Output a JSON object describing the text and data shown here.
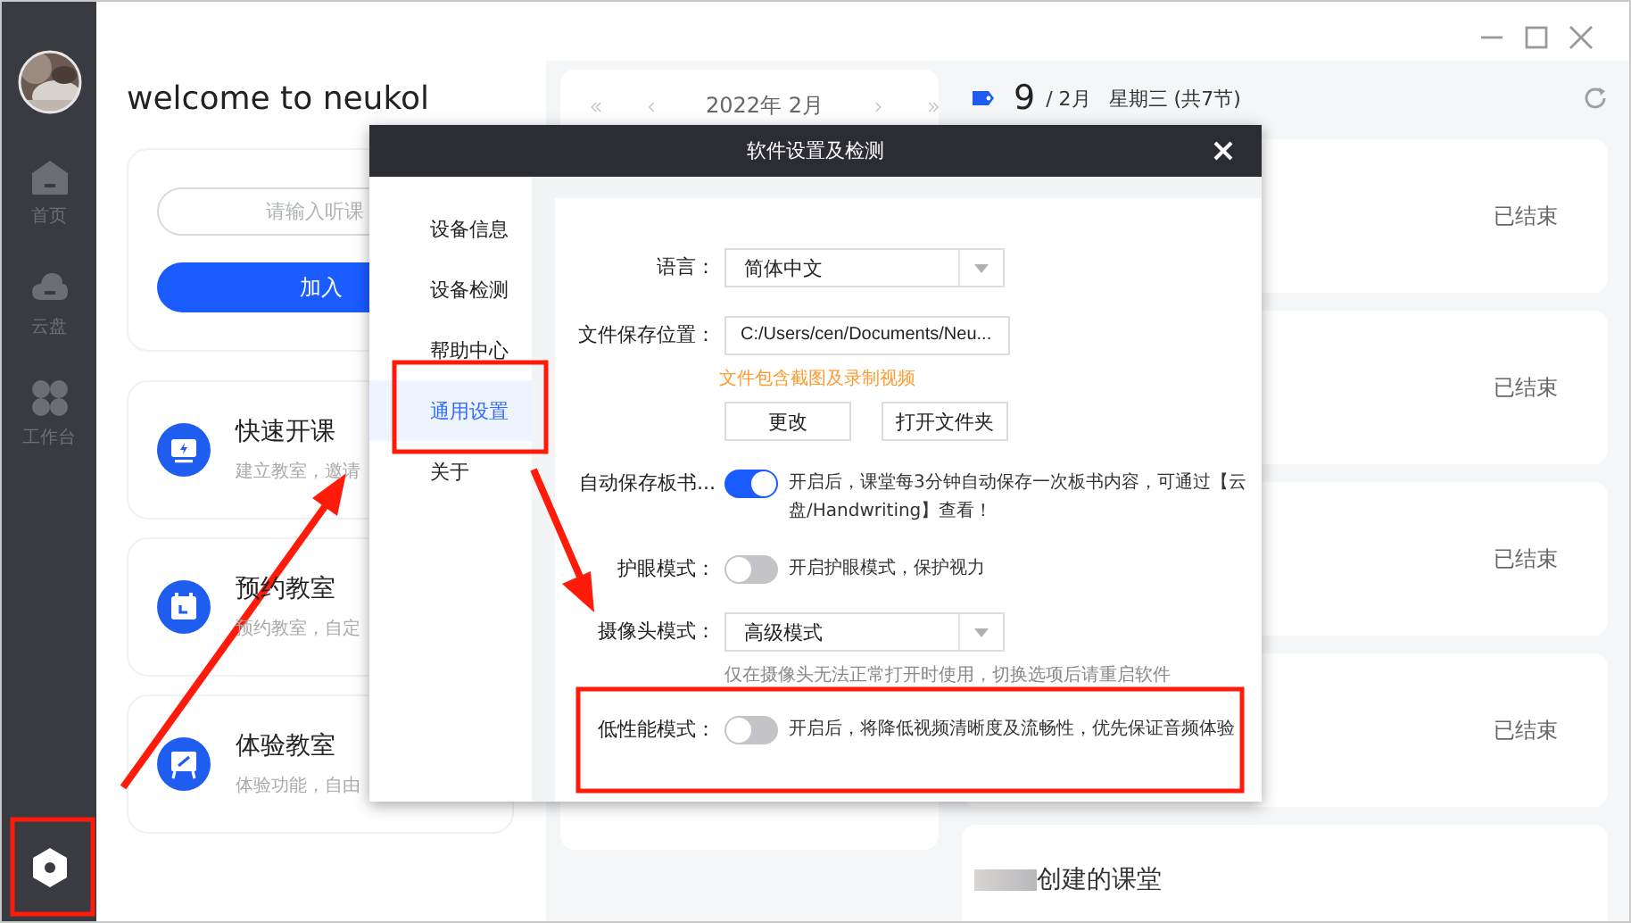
{
  "sidebar": {
    "items": [
      {
        "label": "首页",
        "selected": false
      },
      {
        "label": "云盘",
        "selected": false
      },
      {
        "label": "工作台",
        "selected": false
      }
    ]
  },
  "home": {
    "title": "welcome to neukol",
    "join": {
      "placeholder": "请输入听课",
      "button": "加入"
    },
    "actions": [
      {
        "title": "快速开课",
        "description": "建立教室，邀请"
      },
      {
        "title": "预约教室",
        "description": "预约教室，自定"
      },
      {
        "title": "体验教室",
        "description": "体验功能，自由"
      }
    ]
  },
  "calendar": {
    "title": "2022年 2月"
  },
  "schedule": {
    "day": "9",
    "month": "/ 2月",
    "weekday": "星期三 (共7节)",
    "classes": [
      {
        "status": "已结束"
      },
      {
        "status": "已结束"
      },
      {
        "status": "已结束"
      },
      {
        "status": "已结束"
      }
    ],
    "created_title": "创建的课堂"
  },
  "dialog": {
    "title": "软件设置及检测",
    "nav": [
      {
        "label": "设备信息",
        "selected": false
      },
      {
        "label": "设备检测",
        "selected": false
      },
      {
        "label": "帮助中心",
        "selected": false
      },
      {
        "label": "通用设置",
        "selected": true
      },
      {
        "label": "关于",
        "selected": false
      }
    ],
    "settings": [
      {
        "kind": "select",
        "label": "语言：",
        "value": "简体中文"
      },
      {
        "kind": "path",
        "label": "文件保存位置：",
        "value": "C:/Users/cen/Documents/Neu...",
        "hint": "文件包含截图及录制视频",
        "buttons": [
          "更改",
          "打开文件夹"
        ]
      },
      {
        "kind": "toggle",
        "label": "自动保存板书...",
        "on": true,
        "description": "开启后，课堂每3分钟自动保存一次板书内容，可通过【云盘/Handwriting】查看！"
      },
      {
        "kind": "toggle",
        "label": "护眼模式：",
        "on": false,
        "description": "开启护眼模式，保护视力"
      },
      {
        "kind": "select",
        "label": "摄像头模式：",
        "value": "高级模式",
        "hint": "仅在摄像头无法正常打开时使用，切换选项后请重启软件"
      },
      {
        "kind": "toggle",
        "label": "低性能模式：",
        "on": false,
        "description": "开启后，将降低视频清晰度及流畅性，优先保证音频体验"
      }
    ]
  }
}
